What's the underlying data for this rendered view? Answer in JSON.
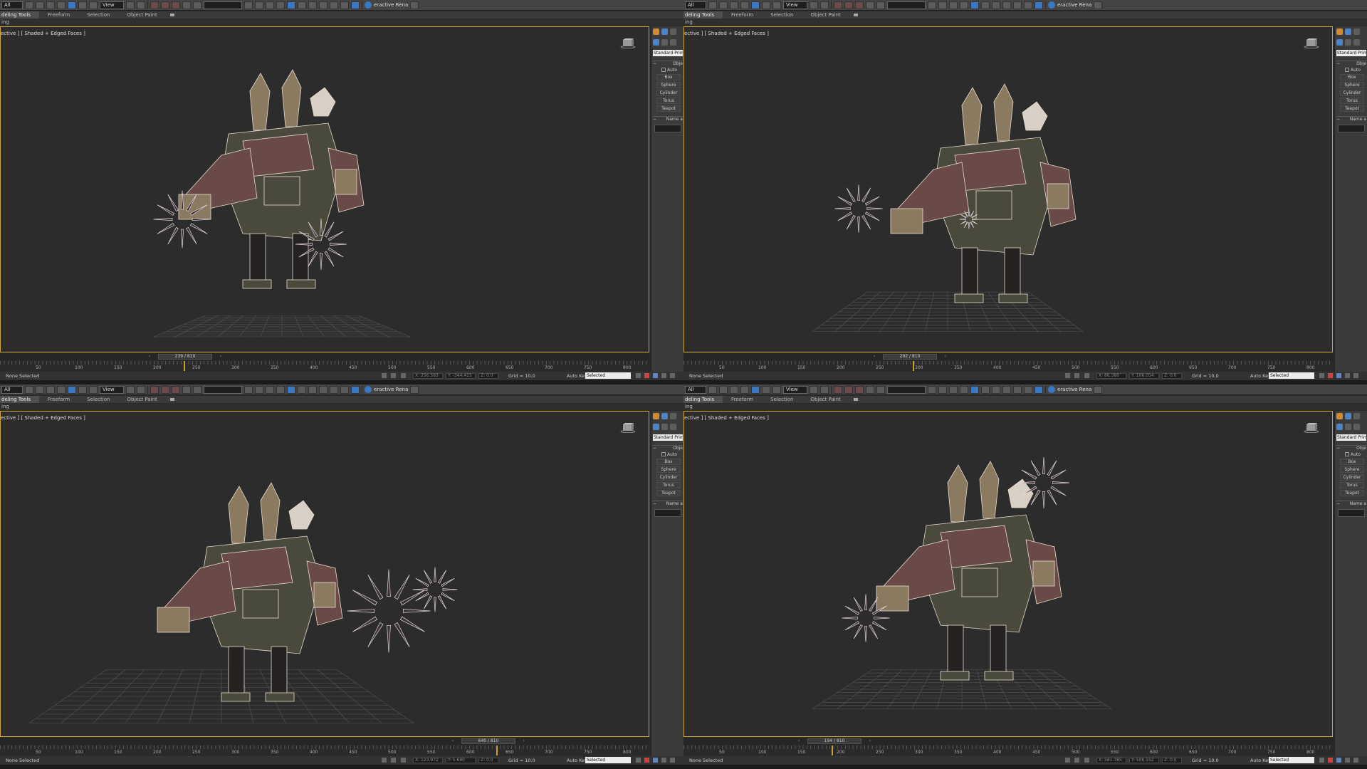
{
  "toolbar": {
    "selection_filter": "All",
    "view_dropdown": "View",
    "render_label": "eractive Rena"
  },
  "ribbon": {
    "tabs": [
      "deling Tools",
      "Freeform",
      "Selection",
      "Object Paint"
    ],
    "subrow": "ing"
  },
  "viewport": {
    "label": "ective ] [ Shaded + Edged Faces ]"
  },
  "command_panel": {
    "category": "Standard Primi",
    "object_type_header": "Obje",
    "autogrid": "Auto",
    "buttons": [
      "Box",
      "Sphere",
      "Cylinder",
      "Torus",
      "Teapot"
    ],
    "name_header": "Name a"
  },
  "trackbar": {
    "ticks": [
      "50",
      "100",
      "150",
      "200",
      "250",
      "300",
      "350",
      "400",
      "450",
      "500",
      "550",
      "600",
      "650",
      "700",
      "750",
      "800"
    ]
  },
  "status": {
    "selection": "None Selected",
    "grid": "Grid = 10.0",
    "autokey": "Auto Key",
    "selected": "Selected"
  },
  "quads": [
    {
      "frame": "239 / 810",
      "x": "X: 256.583",
      "y": "Y: -344.415",
      "z": "Z: 0.0"
    },
    {
      "frame": "292 / 810",
      "x": "X: 86.380",
      "y": "Y: 106.054",
      "z": "Z: 0.0"
    },
    {
      "frame": "640 / 810",
      "x": "X: 123.972",
      "y": "Y: 5.690",
      "z": "Z: 0.0"
    },
    {
      "frame": "194 / 810",
      "x": "X: 581.385",
      "y": "Y: 506.152",
      "z": "Z: 0.0"
    }
  ],
  "colors": {
    "viewport_bg": "#2c2c2c",
    "active_border": "#d1a63a",
    "tan": "#8a7a60",
    "olive": "#4a4a3c",
    "maroon": "#6a4a46",
    "bone": "#d8d0c4",
    "wire": "#e8dccc"
  },
  "icons": [
    "select-icon",
    "move-icon",
    "rotate-icon",
    "scale-icon",
    "snap-icon",
    "mirror-icon",
    "align-icon",
    "render-teapot-icon",
    "viewcube-icon"
  ]
}
